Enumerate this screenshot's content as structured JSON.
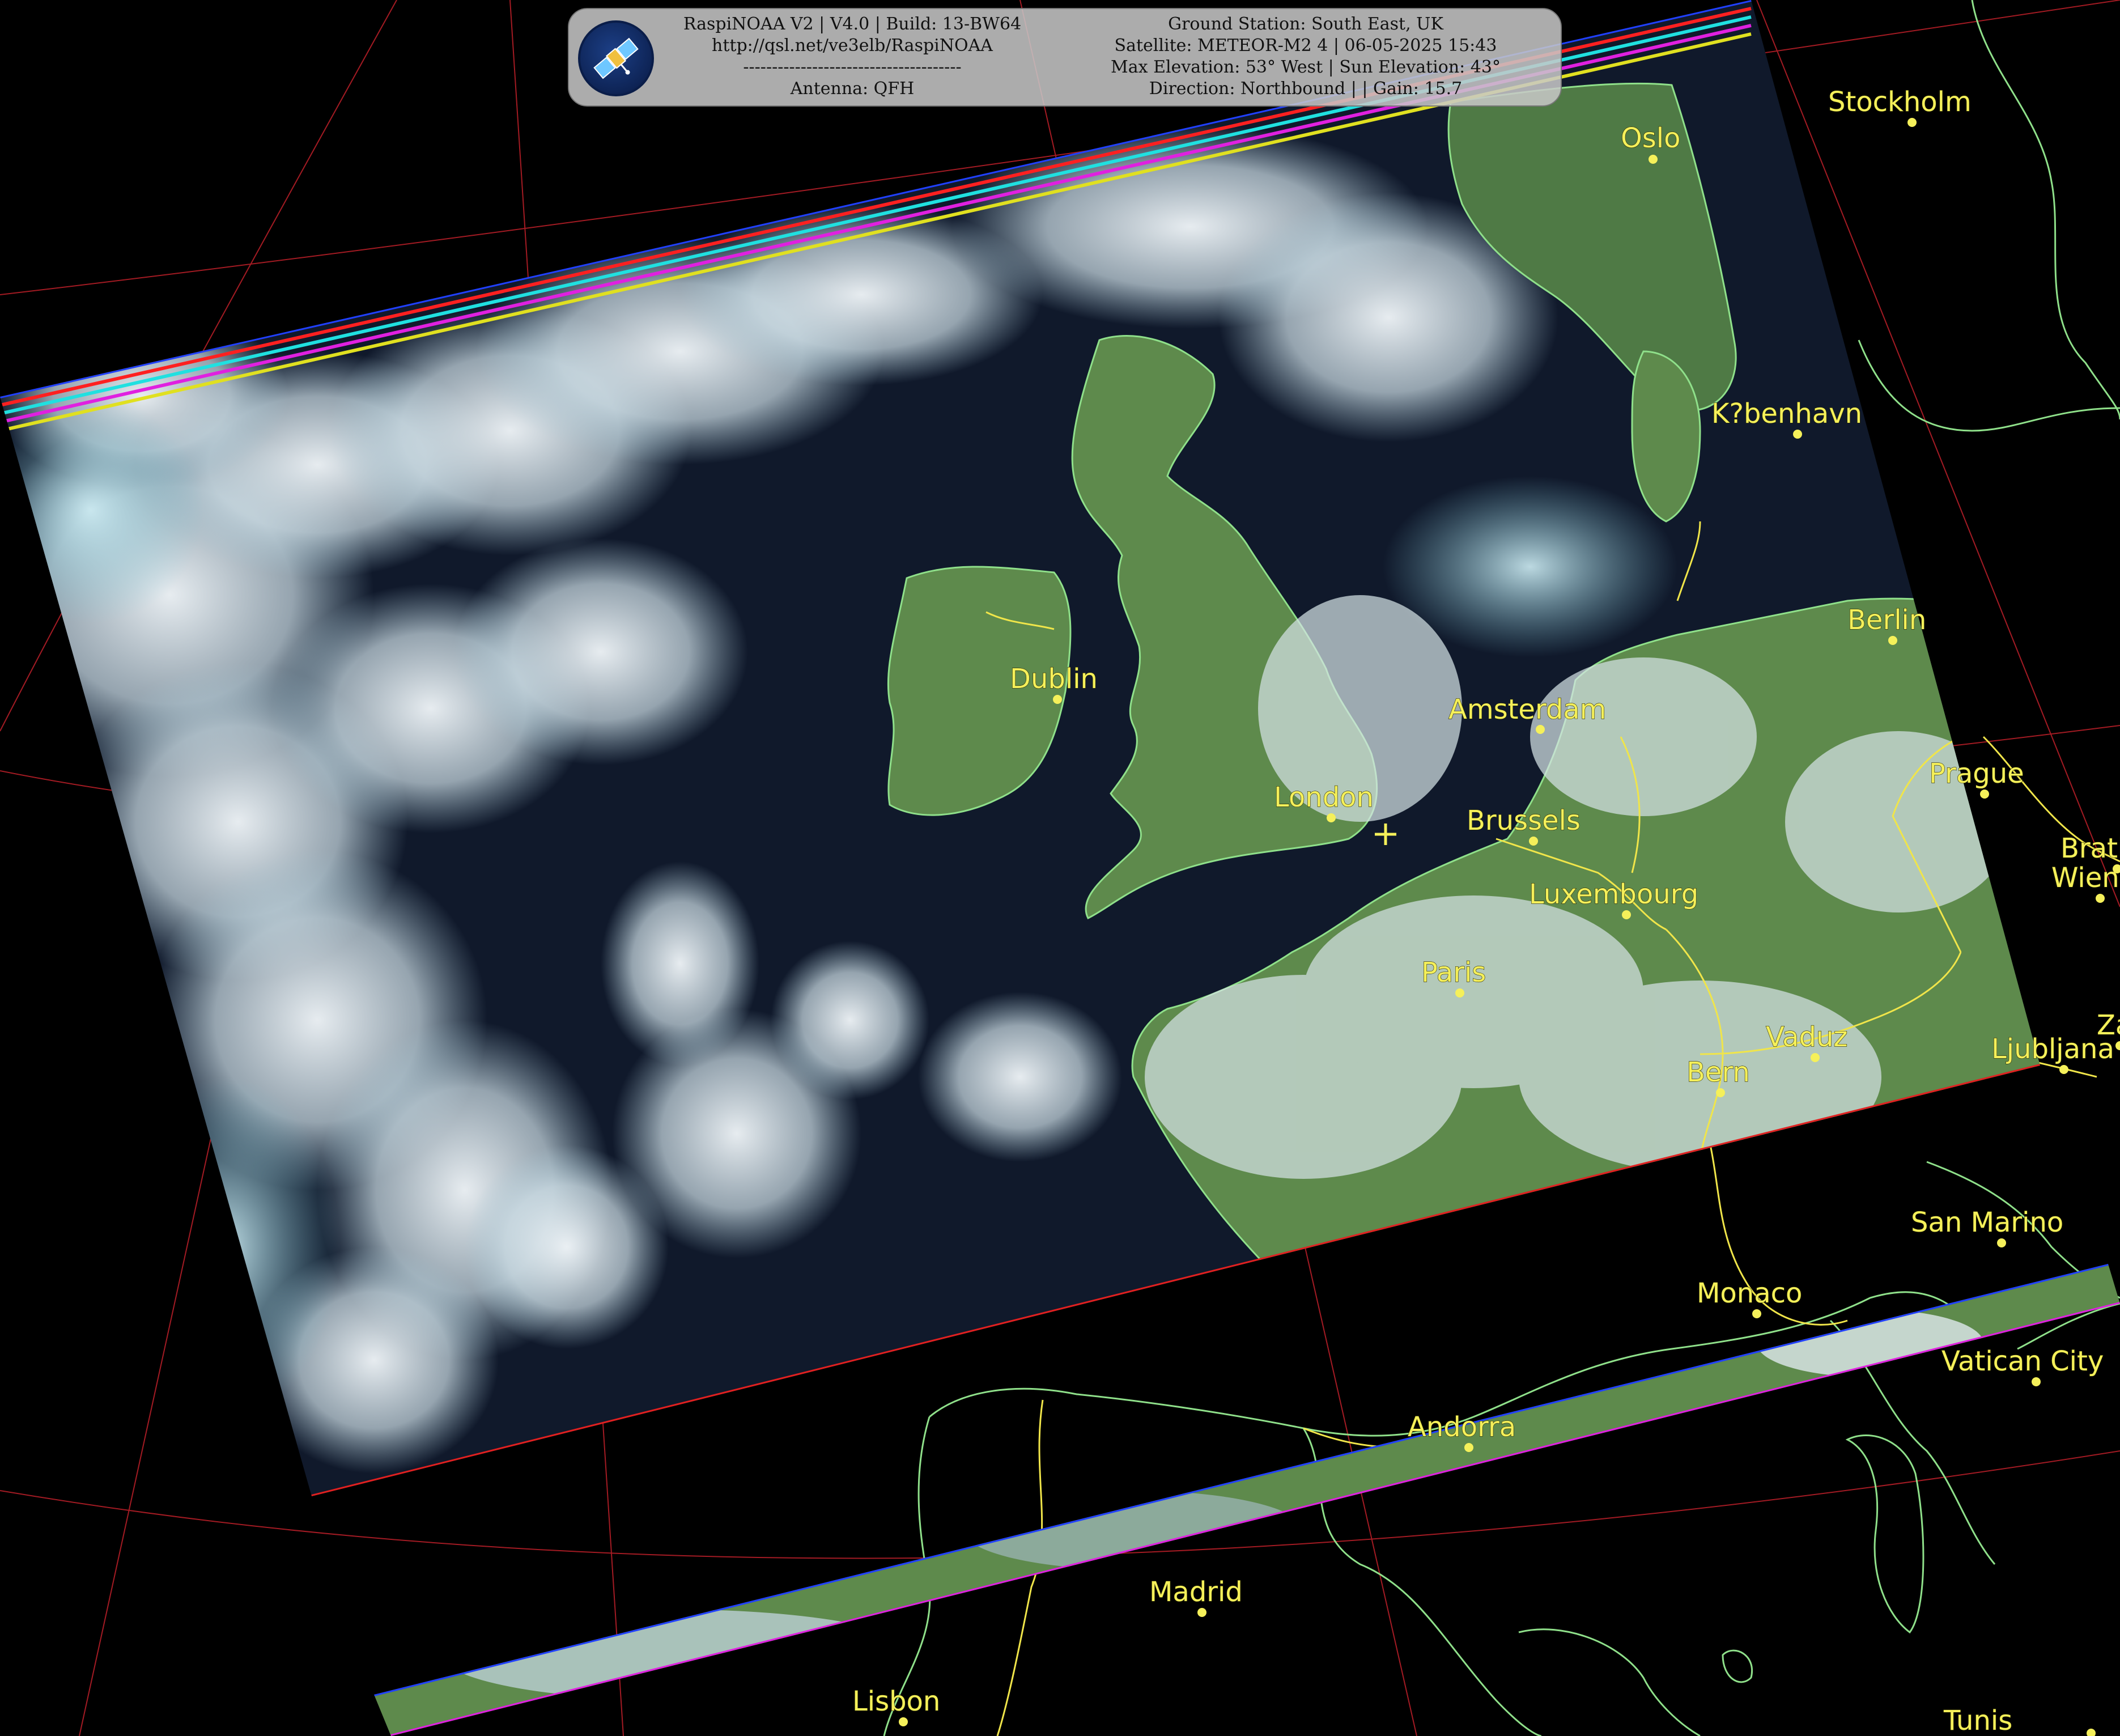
{
  "header": {
    "left_lines": [
      "RaspiNOAA V2 | V4.0 | Build: 13-BW64",
      "http://qsl.net/ve3elb/RaspiNOAA",
      "--------------------------------------",
      "Antenna: QFH"
    ],
    "right_lines": [
      "Ground Station: South East, UK",
      "Satellite: METEOR-M2 4 | 06-05-2025 15:43",
      "Max Elevation: 53° West | Sun Elevation: 43°",
      "Direction: Northbound | | Gain: 15.7"
    ]
  },
  "logo_icon": "satellite-icon",
  "station_marker_icon": "plus-icon",
  "cities": [
    {
      "name": "Stockholm"
    },
    {
      "name": "Oslo"
    },
    {
      "name": "K?benhavn"
    },
    {
      "name": "Berlin"
    },
    {
      "name": "Dublin"
    },
    {
      "name": "Amsterdam"
    },
    {
      "name": "London"
    },
    {
      "name": "Brussels"
    },
    {
      "name": "Prague"
    },
    {
      "name": "Luxembourg"
    },
    {
      "name": "Paris"
    },
    {
      "name": "Vaduz"
    },
    {
      "name": "Bern"
    },
    {
      "name": "Ljubljana"
    },
    {
      "name": "San Marino"
    },
    {
      "name": "Monaco"
    },
    {
      "name": "Vatican City"
    },
    {
      "name": "Andorra"
    },
    {
      "name": "Madrid"
    },
    {
      "name": "Lisbon"
    },
    {
      "name": "Wien"
    },
    {
      "name": "Bratislava"
    },
    {
      "name": "Zagreb"
    },
    {
      "name": "Tunis"
    }
  ],
  "colors": {
    "city_label": "#f5f05a",
    "coastline": "#8fe08a",
    "border": "#f0e54a",
    "graticule": "#c0202a",
    "ocean": "#10192b",
    "cloud": "#dfe9ee",
    "land": "#5e8a4c"
  }
}
